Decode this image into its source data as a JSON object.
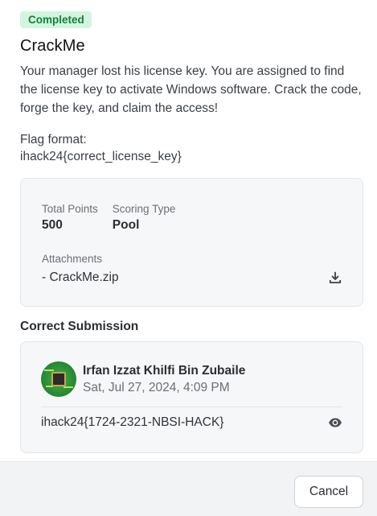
{
  "challenge": {
    "status_badge": "Completed",
    "title": "CrackMe",
    "description": "Your manager lost his license key. You are assigned to find the license key to activate Windows software. Crack the code, forge the key, and claim the access!",
    "flag_format_label": "Flag format:",
    "flag_format_value": "ihack24{correct_license_key}"
  },
  "info": {
    "total_points_label": "Total Points",
    "total_points_value": "500",
    "scoring_type_label": "Scoring Type",
    "scoring_type_value": "Pool",
    "attachments_label": "Attachments",
    "attachments": [
      {
        "name": "- CrackMe.zip",
        "icon": "download-icon"
      }
    ]
  },
  "submission": {
    "section_title": "Correct Submission",
    "user_name": "Irfan Izzat Khilfi Bin Zubaile",
    "timestamp": "Sat, Jul 27, 2024, 4:09 PM",
    "flag": "ihack24{1724-2321-NBSI-HACK}",
    "reveal_icon": "eye-icon"
  },
  "footer": {
    "cancel_label": "Cancel"
  },
  "colors": {
    "badge_bg": "#d3f5df",
    "badge_text": "#13803f",
    "card_bg": "#f6f7f8",
    "footer_bg": "#f2f3f4"
  }
}
